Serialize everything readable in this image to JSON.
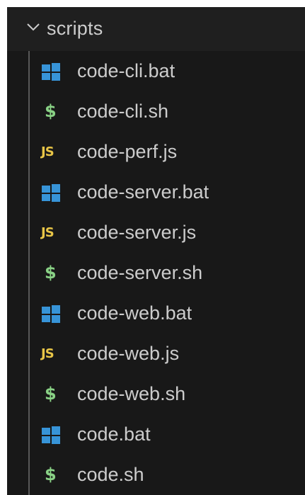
{
  "explorer": {
    "folder": {
      "name": "scripts",
      "expanded": true,
      "chevron_icon": "chevron-down-icon"
    },
    "colors": {
      "background": "#181818",
      "folder_row_background": "#1f1f1f",
      "text": "#cccccc",
      "windows_icon": "#3794d8",
      "shell_icon": "#89d185",
      "js_icon": "#e8c547"
    },
    "files": [
      {
        "name": "code-cli.bat",
        "icon": "windows-icon"
      },
      {
        "name": "code-cli.sh",
        "icon": "shell-icon"
      },
      {
        "name": "code-perf.js",
        "icon": "js-icon"
      },
      {
        "name": "code-server.bat",
        "icon": "windows-icon"
      },
      {
        "name": "code-server.js",
        "icon": "js-icon"
      },
      {
        "name": "code-server.sh",
        "icon": "shell-icon"
      },
      {
        "name": "code-web.bat",
        "icon": "windows-icon"
      },
      {
        "name": "code-web.js",
        "icon": "js-icon"
      },
      {
        "name": "code-web.sh",
        "icon": "shell-icon"
      },
      {
        "name": "code.bat",
        "icon": "windows-icon"
      },
      {
        "name": "code.sh",
        "icon": "shell-icon"
      }
    ],
    "icon_glyphs": {
      "js": "JS",
      "shell": "$"
    }
  }
}
